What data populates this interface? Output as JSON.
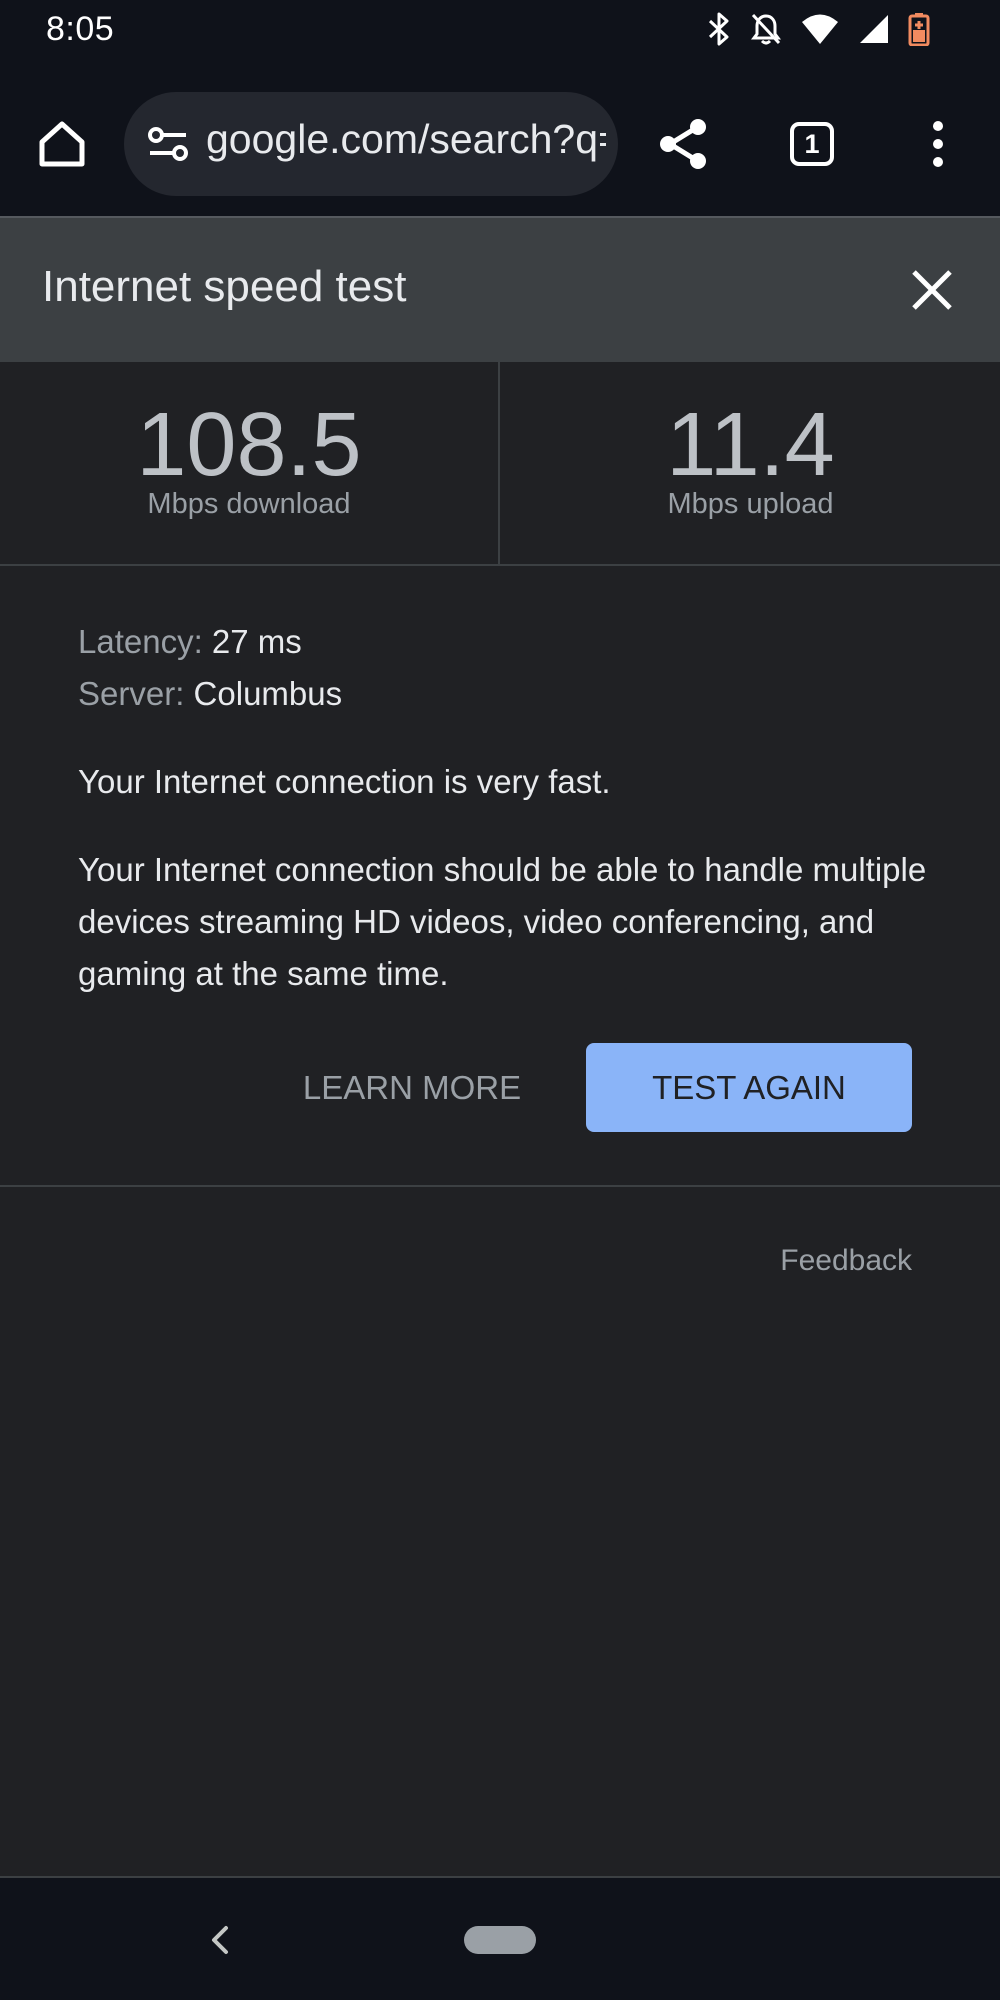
{
  "status_bar": {
    "time": "8:05",
    "icons": [
      "bluetooth-icon",
      "notifications-off-icon",
      "wifi-icon",
      "signal-icon",
      "battery-charging-icon"
    ]
  },
  "toolbar": {
    "url": "google.com/search?q=speed+test",
    "tab_count": "1"
  },
  "speed_test": {
    "title": "Internet speed test",
    "download_value": "108.5",
    "download_label": "Mbps download",
    "upload_value": "11.4",
    "upload_label": "Mbps upload",
    "latency_label": "Latency:",
    "latency_value": "27 ms",
    "server_label": "Server:",
    "server_value": "Columbus",
    "summary": "Your Internet connection is very fast.",
    "detail": "Your Internet connection should be able to handle multiple devices streaming HD videos, video conferencing, and gaming at the same time.",
    "learn_more_label": "LEARN MORE",
    "test_again_label": "TEST AGAIN",
    "feedback_label": "Feedback"
  },
  "colors": {
    "accent": "#8ab4f8",
    "background": "#202124",
    "header": "#3c4043",
    "battery": "#f28b60"
  }
}
